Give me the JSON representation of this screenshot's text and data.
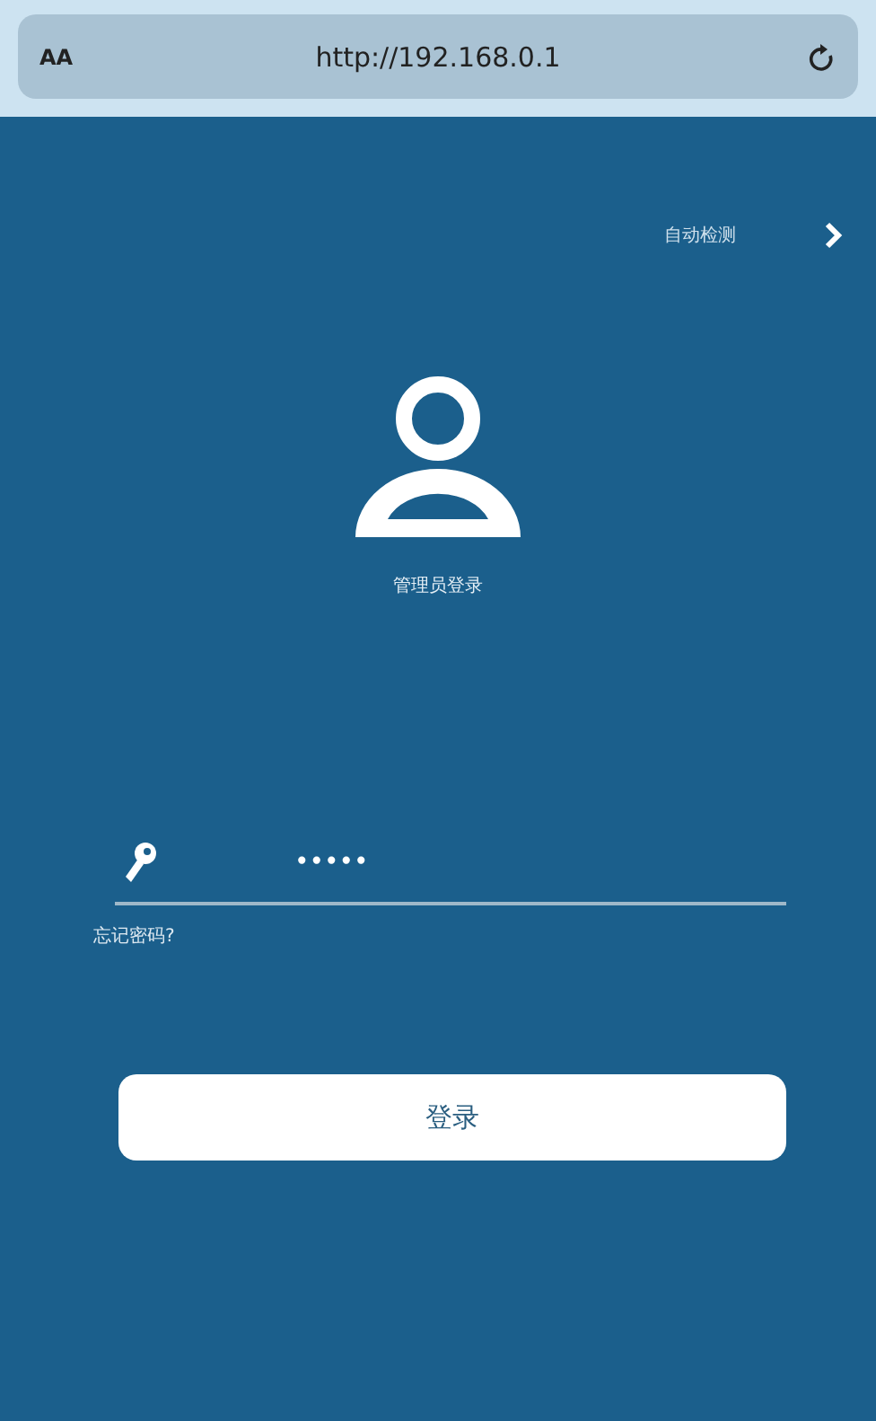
{
  "browser_bar": {
    "text_size": "AA",
    "url": "http://192.168.0.1"
  },
  "header": {
    "link": "自动检测"
  },
  "profile": {
    "title": "管理员登录"
  },
  "password_field": {
    "value": "•••••"
  },
  "forgot_link": "忘记密码?",
  "buttons": [
    "登录"
  ]
}
